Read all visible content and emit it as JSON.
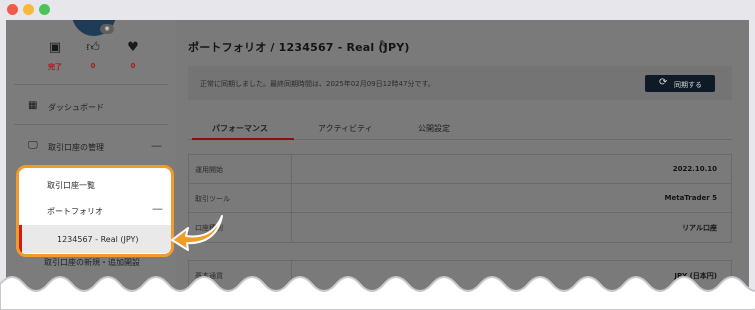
{
  "window": {
    "controls": [
      "close",
      "minimize",
      "maximize"
    ]
  },
  "sidebar": {
    "stats": [
      {
        "icon": "completed-icon",
        "value": "完了"
      },
      {
        "icon": "thumbs-up-icon",
        "value": "0"
      },
      {
        "icon": "heart-icon",
        "value": "0"
      }
    ],
    "nav": {
      "dashboard": "ダッシュボード",
      "account_management": "取引口座の管理",
      "account_list": "取引口座一覧",
      "portfolio": "ポートフォリオ",
      "portfolio_account": "1234567 - Real (JPY)",
      "new_account": "取引口座の新規・追加開設"
    }
  },
  "main": {
    "title": "ポートフォリオ / 1234567 - Real (JPY)",
    "sync": {
      "message": "正常に同期しました。最終同期時間は、2025年02月09日12時47分です。",
      "button": "同期する"
    },
    "tabs": [
      "パフォーマンス",
      "アクティビティ",
      "公開設定"
    ],
    "details": [
      {
        "key": "運用開始",
        "value": "2022.10.10"
      },
      {
        "key": "取引ツール",
        "value": "MetaTrader 5"
      },
      {
        "key": "口座種別",
        "value": "リアル口座"
      },
      {
        "key": "基本通貨",
        "value": "JPY (日本円)"
      }
    ]
  },
  "colors": {
    "accent_orange": "#f29b2d",
    "active_red": "#d11a1a",
    "sync_button": "#0e1a26"
  }
}
